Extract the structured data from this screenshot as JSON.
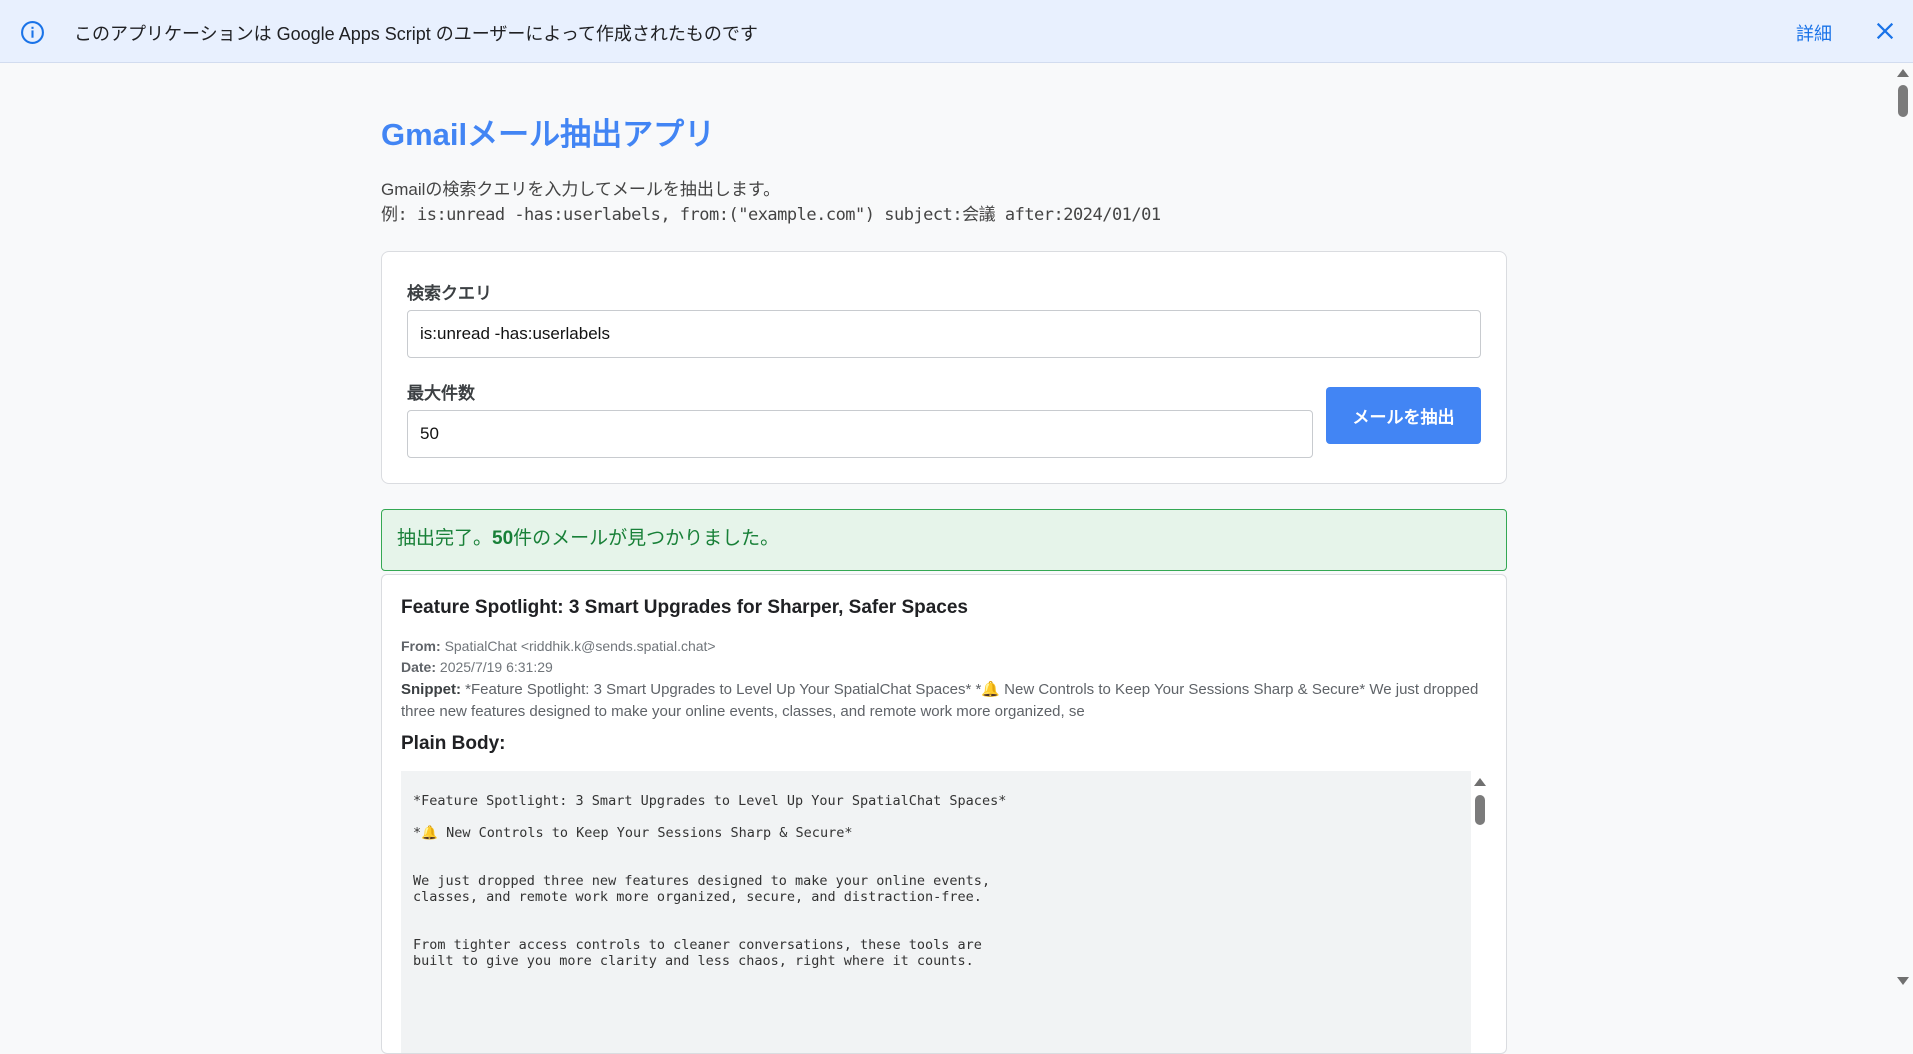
{
  "banner": {
    "text": "このアプリケーションは Google Apps Script のユーザーによって作成されたものです",
    "details_link": "詳細",
    "info_icon": "info-icon",
    "close_icon": "close-icon"
  },
  "app": {
    "title": "Gmailメール抽出アプリ",
    "description": "Gmailの検索クエリを入力してメールを抽出します。",
    "example": "例: is:unread -has:userlabels, from:(\"example.com\") subject:会議 after:2024/01/01"
  },
  "form": {
    "query_label": "検索クエリ",
    "query_value": "is:unread -has:userlabels",
    "max_label": "最大件数",
    "max_value": "50",
    "extract_button": "メールを抽出"
  },
  "status": {
    "prefix": "抽出完了。",
    "count": "50",
    "suffix": "件のメールが見つかりました。"
  },
  "result": {
    "subject": "Feature Spotlight: 3 Smart Upgrades for Sharper, Safer Spaces",
    "from_label": "From:",
    "from_value": "SpatialChat <riddhik.k@sends.spatial.chat>",
    "date_label": "Date:",
    "date_value": "2025/7/19 6:31:29",
    "snippet_label": "Snippet:",
    "snippet_value": "*Feature Spotlight: 3 Smart Upgrades to Level Up Your SpatialChat Spaces* *🔔 New Controls to Keep Your Sessions Sharp & Secure* We just dropped three new features designed to make your online events, classes, and remote work more organized, se",
    "plain_body_label": "Plain Body:",
    "plain_body": "*Feature Spotlight: 3 Smart Upgrades to Level Up Your SpatialChat Spaces*\n\n*🔔 New Controls to Keep Your Sessions Sharp & Secure*\n\n\nWe just dropped three new features designed to make your online events,\nclasses, and remote work more organized, secure, and distraction-free.\n\n\nFrom tighter access controls to cleaner conversations, these tools are\nbuilt to give you more clarity and less chaos, right where it counts."
  },
  "colors": {
    "accent": "#4285f4",
    "success": "#188038",
    "banner_bg": "#e8f0fe"
  }
}
